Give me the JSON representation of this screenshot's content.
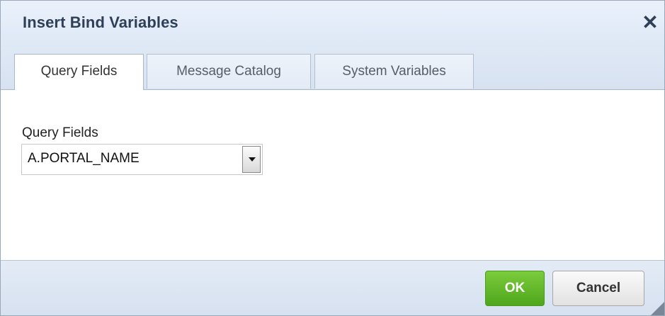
{
  "dialog": {
    "title": "Insert Bind Variables",
    "close_icon": "close-icon",
    "close_glyph": "✕"
  },
  "tabs": [
    {
      "label": "Query Fields",
      "active": true
    },
    {
      "label": "Message Catalog",
      "active": false
    },
    {
      "label": "System Variables",
      "active": false
    }
  ],
  "content": {
    "field_label": "Query Fields",
    "select_value": "A.PORTAL_NAME"
  },
  "footer": {
    "ok_label": "OK",
    "cancel_label": "Cancel"
  },
  "colors": {
    "ok_green": "#5ab52a",
    "title_text": "#2e3f57"
  }
}
